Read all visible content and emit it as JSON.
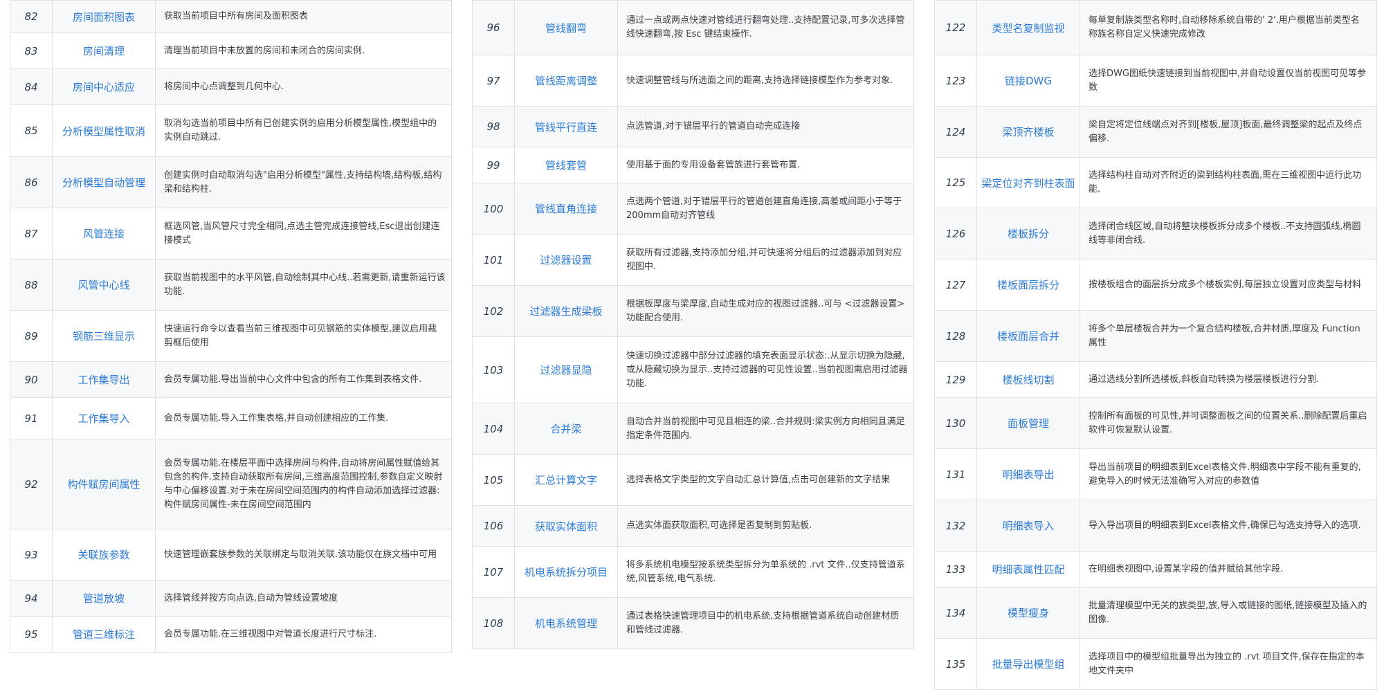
{
  "columns": [
    {
      "rows": [
        {
          "num": "82",
          "name": "房间面积图表",
          "desc": "获取当前项目中所有房间及面积图表"
        },
        {
          "num": "83",
          "name": "房间清理",
          "desc": "清理当前项目中未放置的房间和未闭合的房间实例."
        },
        {
          "num": "84",
          "name": "房间中心适应",
          "desc": "将房间中心点调整到几何中心."
        },
        {
          "num": "85",
          "name": "分析模型属性取消",
          "desc": "取消勾选当前项目中所有已创建实例的启用分析模型属性,模型组中的实例自动跳过."
        },
        {
          "num": "86",
          "name": "分析模型自动管理",
          "desc": "创建实例时自动取消勾选\"启用分析模型\"属性,支持结构墙,结构板,结构梁和结构柱."
        },
        {
          "num": "87",
          "name": "风管连接",
          "desc": "框选风管,当风管尺寸完全相同,点选主管完成连接管线,Esc退出创建连接模式"
        },
        {
          "num": "88",
          "name": "风管中心线",
          "desc": "获取当前视图中的水平风管,自动绘制其中心线..若需更新,请重新运行该功能."
        },
        {
          "num": "89",
          "name": "钢筋三维显示",
          "desc": "快速运行命令以查看当前三维视图中可见钢筋的实体模型,建议启用裁剪框后使用"
        },
        {
          "num": "90",
          "name": "工作集导出",
          "desc": "会员专属功能.导出当前中心文件中包含的所有工作集到表格文件."
        },
        {
          "num": "91",
          "name": "工作集导入",
          "desc": "会员专属功能.导入工作集表格,并自动创建相应的工作集."
        },
        {
          "num": "92",
          "name": "构件赋房间属性",
          "desc": "会员专属功能.在楼层平面中选择房间与构件,自动将房间属性赋值给其包含的构件.支持自动获取所有房间,三维高度范围控制,参数自定义映射与中心偏移设置.对于未在房间空间范围内的构件自动添加选择过滤器:构件赋房间属性-未在房间空间范围内"
        },
        {
          "num": "93",
          "name": "关联族参数",
          "desc": "快速管理嵌套族参数的关联绑定与取消关联.该功能仅在族文档中可用"
        },
        {
          "num": "94",
          "name": "管道放坡",
          "desc": "选择管线并按方向点选,自动为管线设置坡度"
        },
        {
          "num": "95",
          "name": "管道三维标注",
          "desc": "会员专属功能.在三维视图中对管道长度进行尺寸标注."
        }
      ]
    },
    {
      "rows": [
        {
          "num": "96",
          "name": "管线翻弯",
          "desc": "通过一点或两点快速对管线进行翻弯处理..支持配置记录,可多次选择管线快速翻弯,按 Esc 键结束操作."
        },
        {
          "num": "97",
          "name": "管线距离调整",
          "desc": "快速调整管线与所选面之间的距离,支持选择链接模型作为参考对象."
        },
        {
          "num": "98",
          "name": "管线平行直连",
          "desc": "点选管道,对于错层平行的管道自动完成连接"
        },
        {
          "num": "99",
          "name": "管线套管",
          "desc": "使用基于面的专用设备套管族进行套管布置."
        },
        {
          "num": "100",
          "name": "管线直角连接",
          "desc": "点选两个管道,对于错层平行的管道创建直角连接,高差或间距小于等于200mm自动对齐管线"
        },
        {
          "num": "101",
          "name": "过滤器设置",
          "desc": "获取所有过滤器,支持添加分组,并可快速将分组后的过滤器添加到对应视图中."
        },
        {
          "num": "102",
          "name": "过滤器生成梁板",
          "desc": "根据板厚度与梁厚度,自动生成对应的视图过滤器..可与 <过滤器设置> 功能配合使用."
        },
        {
          "num": "103",
          "name": "过滤器显隐",
          "desc": "快速切换过滤器中部分过滤器的填充表面显示状态:.从显示切换为隐藏,或从隐藏切换为显示..支持过滤器的可见性设置..当前视图需启用过滤器功能."
        },
        {
          "num": "104",
          "name": "合并梁",
          "desc": "自动合并当前视图中可见且相连的梁..合并规则:梁实例方向相同且满足指定条件范围内."
        },
        {
          "num": "105",
          "name": "汇总计算文字",
          "desc": "选择表格文字类型的文字自动汇总计算值,点击可创建新的文字结果"
        },
        {
          "num": "106",
          "name": "获取实体面积",
          "desc": "点选实体面获取面积,可选择是否复制到剪贴板."
        },
        {
          "num": "107",
          "name": "机电系统拆分项目",
          "desc": "将多系统机电模型按系统类型拆分为单系统的 .rvt 文件..仅支持管道系统,风管系统,电气系统."
        },
        {
          "num": "108",
          "name": "机电系统管理",
          "desc": "通过表格快速管理项目中的机电系统,支持根据管道系统自动创建材质和管线过滤器."
        }
      ]
    },
    {
      "rows": [
        {
          "num": "122",
          "name": "类型名复制监视",
          "desc": "每单复制族类型名称时,自动移除系统自带的' 2'.用户根据当前类型名称族名称自定义快速完成修改"
        },
        {
          "num": "123",
          "name": "链接DWG",
          "desc": "选择DWG图纸快速链接到当前视图中,并自动设置仅当前视图可见等参数"
        },
        {
          "num": "124",
          "name": "梁顶齐楼板",
          "desc": "梁自定将定位线端点对齐到[楼板,屋顶]板面,最终调整梁的起点及终点偏移."
        },
        {
          "num": "125",
          "name": "梁定位对齐到柱表面",
          "desc": "选择结构柱自动对齐附近的梁到结构柱表面,需在三维视图中运行此功能."
        },
        {
          "num": "126",
          "name": "楼板拆分",
          "desc": "选择闭合线区域,自动将整块楼板拆分成多个楼板..不支持圆弧线,椭圆线等非闭合线."
        },
        {
          "num": "127",
          "name": "楼板面层拆分",
          "desc": "按楼板组合的面层拆分成多个楼板实例,每层独立设置对应类型与材料"
        },
        {
          "num": "128",
          "name": "楼板面层合并",
          "desc": "将多个单层楼板合并为一个复合结构楼板,合并材质,厚度及 Function 属性"
        },
        {
          "num": "129",
          "name": "楼板线切割",
          "desc": "通过选线分割所选楼板,斜板自动转换为楼层楼板进行分割."
        },
        {
          "num": "130",
          "name": "面板管理",
          "desc": "控制所有面板的可见性,并可调整面板之间的位置关系..删除配置后重启软件可恢复默认设置."
        },
        {
          "num": "131",
          "name": "明细表导出",
          "desc": "导出当前项目的明细表到Excel表格文件.明细表中字段不能有重复的,避免导入的时候无法准确写入对应的参数值"
        },
        {
          "num": "132",
          "name": "明细表导入",
          "desc": "导入导出项目的明细表到Excel表格文件,确保已勾选支持导入的选项."
        },
        {
          "num": "133",
          "name": "明细表属性匹配",
          "desc": "在明细表视图中,设置某字段的值并赋给其他字段."
        },
        {
          "num": "134",
          "name": "模型瘦身",
          "desc": "批量清理模型中无关的族类型,族,导入或链接的图纸,链接模型及插入的图像."
        },
        {
          "num": "135",
          "name": "批量导出模型组",
          "desc": "选择项目中的模型组批量导出为独立的 .rvt 项目文件,保存在指定的本地文件夹中"
        }
      ]
    }
  ]
}
